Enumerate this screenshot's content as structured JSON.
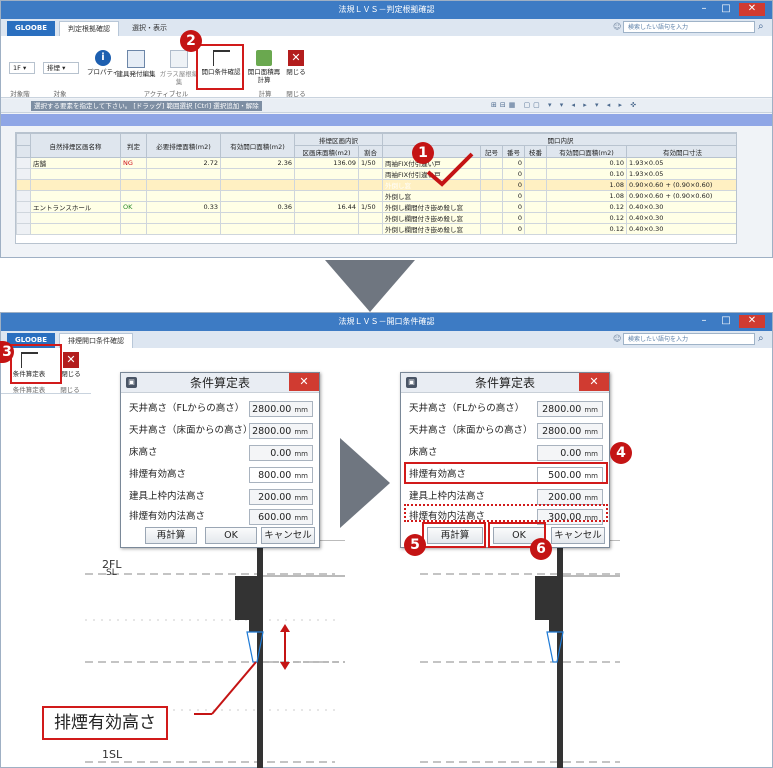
{
  "top_window": {
    "title": "法規ＬＶＳ－判定根拠確認",
    "tabs": [
      "GLOOBE",
      "判定根拠確認",
      "選択・表示"
    ],
    "search_placeholder": "検索したい語句を入力",
    "floor_combo": "1F",
    "kind_combo": "排煙",
    "ribbon_buttons": [
      "プロパティ",
      "建具発付編集",
      "ガラス屋根編集",
      "開口条件確認",
      "開口面積再計算",
      "閉じる"
    ],
    "ribbon_groups": [
      "対象階",
      "対象",
      "アクティブセル",
      "計算",
      "閉じる"
    ],
    "hint": "選択する要素を指定して下さい。 [ドラッグ] 範囲選択 [Ctrl] 選択追加・解除",
    "table": {
      "group_headers": [
        "排煙区画内訳",
        "開口内訳"
      ],
      "headers": [
        "自然排煙区画名称",
        "判定",
        "必要排煙面積(m2)",
        "有効開口面積(m2)",
        "区画床面積(m2)",
        "割合",
        "",
        "記号",
        "番号",
        "枝番",
        "有効開口面積(m2)",
        "有効開口寸法"
      ],
      "rows": [
        [
          "店舗",
          "NG",
          "2.72",
          "2.36",
          "136.09",
          "1/50",
          "両袖FIX付引違い戸",
          "",
          "0",
          "",
          "0.10",
          "1.93×0.05"
        ],
        [
          "",
          "",
          "",
          "",
          "",
          "",
          "両袖FIX付引違い戸",
          "",
          "0",
          "",
          "0.10",
          "1.93×0.05"
        ],
        [
          "",
          "",
          "",
          "",
          "",
          "",
          "外倒し窓",
          "",
          "0",
          "",
          "1.08",
          "0.90×0.60 + (0.90×0.60)"
        ],
        [
          "",
          "",
          "",
          "",
          "",
          "",
          "外倒し窓",
          "",
          "0",
          "",
          "1.08",
          "0.90×0.60 + (0.90×0.60)"
        ],
        [
          "エントランスホール",
          "OK",
          "0.33",
          "0.36",
          "16.44",
          "1/50",
          "外倒し欄間付き嵌め殺し窓",
          "",
          "0",
          "",
          "0.12",
          "0.40×0.30"
        ],
        [
          "",
          "",
          "",
          "",
          "",
          "",
          "外倒し欄間付き嵌め殺し窓",
          "",
          "0",
          "",
          "0.12",
          "0.40×0.30"
        ],
        [
          "",
          "",
          "",
          "",
          "",
          "",
          "外倒し欄間付き嵌め殺し窓",
          "",
          "0",
          "",
          "0.12",
          "0.40×0.30"
        ]
      ]
    }
  },
  "bottom_window": {
    "title": "法規ＬＶＳ－開口条件確認",
    "tabs": [
      "GLOOBE",
      "排煙開口条件確認"
    ],
    "search_placeholder": "検索したい語句を入力",
    "ribbon_buttons": [
      "条件算定表",
      "閉じる"
    ],
    "ribbon_groups": [
      "条件算定表",
      "閉じる"
    ]
  },
  "dialog_before": {
    "title": "条件算定表",
    "rows": [
      {
        "label": "天井高さ（FLからの高さ）",
        "value": "2800.00",
        "unit": "mm"
      },
      {
        "label": "天井高さ（床面からの高さ）",
        "value": "2800.00",
        "unit": "mm"
      },
      {
        "label": "床高さ",
        "value": "0.00",
        "unit": "mm"
      },
      {
        "label": "排煙有効高さ",
        "value": "800.00",
        "unit": "mm"
      },
      {
        "label": "建具上枠内法高さ",
        "value": "200.00",
        "unit": "mm"
      },
      {
        "label": "排煙有効内法高さ",
        "value": "600.00",
        "unit": "mm"
      }
    ],
    "buttons": [
      "再計算",
      "OK",
      "キャンセル"
    ]
  },
  "dialog_after": {
    "title": "条件算定表",
    "rows": [
      {
        "label": "天井高さ（FLからの高さ）",
        "value": "2800.00",
        "unit": "mm"
      },
      {
        "label": "天井高さ（床面からの高さ）",
        "value": "2800.00",
        "unit": "mm"
      },
      {
        "label": "床高さ",
        "value": "0.00",
        "unit": "mm"
      },
      {
        "label": "排煙有効高さ",
        "value": "500.00",
        "unit": "mm"
      },
      {
        "label": "建具上枠内法高さ",
        "value": "200.00",
        "unit": "mm"
      },
      {
        "label": "排煙有効内法高さ",
        "value": "300.00",
        "unit": "mm"
      }
    ],
    "buttons": [
      "再計算",
      "OK",
      "キャンセル"
    ]
  },
  "drawing": {
    "level_2": "2FL",
    "level_2_sub": "SL",
    "level_1": "1SL",
    "callout_label": "排煙有効高さ"
  },
  "steps": [
    "1",
    "2",
    "3",
    "4",
    "5",
    "6"
  ],
  "colors": {
    "accent": "#3d7bc4",
    "highlight": "#d11a1a",
    "ng": "#d0101a",
    "ok": "#2a8a2a"
  }
}
